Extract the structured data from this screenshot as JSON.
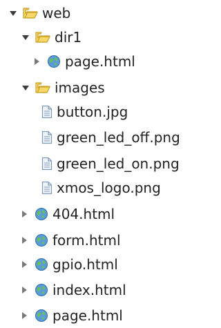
{
  "tree": [
    {
      "label": "web",
      "kind": "folder",
      "state": "expanded",
      "depth": 0
    },
    {
      "label": "dir1",
      "kind": "folder",
      "state": "expanded",
      "depth": 1
    },
    {
      "label": "page.html",
      "kind": "html",
      "state": "collapsed",
      "depth": 2
    },
    {
      "label": "images",
      "kind": "folder",
      "state": "expanded",
      "depth": 1
    },
    {
      "label": "button.jpg",
      "kind": "file",
      "state": "none",
      "depth": 2
    },
    {
      "label": "green_led_off.png",
      "kind": "file",
      "state": "none",
      "depth": 2
    },
    {
      "label": "green_led_on.png",
      "kind": "file",
      "state": "none",
      "depth": 2
    },
    {
      "label": "xmos_logo.png",
      "kind": "file",
      "state": "none",
      "depth": 2
    },
    {
      "label": "404.html",
      "kind": "html",
      "state": "collapsed",
      "depth": 1
    },
    {
      "label": "form.html",
      "kind": "html",
      "state": "collapsed",
      "depth": 1
    },
    {
      "label": "gpio.html",
      "kind": "html",
      "state": "collapsed",
      "depth": 1
    },
    {
      "label": "index.html",
      "kind": "html",
      "state": "collapsed",
      "depth": 1
    },
    {
      "label": "page.html",
      "kind": "html",
      "state": "collapsed",
      "depth": 1
    }
  ],
  "icons": {
    "folder": "folder-open-icon",
    "html": "web-page-globe-icon",
    "file": "file-icon"
  },
  "colors": {
    "folder_fill": "#f6d768",
    "folder_stroke": "#c9a227",
    "globe": "#5a9bd8",
    "globe_land": "#6bbf59",
    "file_border": "#7f9ab8",
    "file_fill": "#eef3f9",
    "toggle": "#444444",
    "text": "#222222"
  }
}
